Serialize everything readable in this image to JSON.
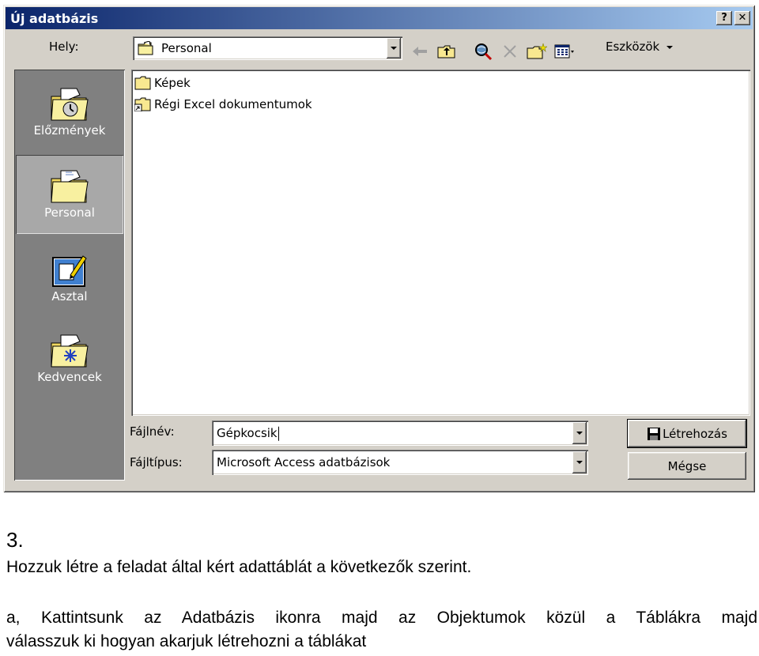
{
  "dialog": {
    "title": "Új adatbázis",
    "help_button": "?",
    "close_button": "✕",
    "location_label": "Hely:",
    "location_value": "Personal",
    "tools_label": "Eszközök"
  },
  "sidebar": {
    "items": [
      {
        "label": "Előzmények",
        "icon": "history-folder-icon"
      },
      {
        "label": "Personal",
        "icon": "personal-folder-icon",
        "selected": true
      },
      {
        "label": "Asztal",
        "icon": "desktop-icon"
      },
      {
        "label": "Kedvencek",
        "icon": "favorites-folder-icon"
      }
    ]
  },
  "files": [
    {
      "name": "Képek",
      "icon": "folder-icon"
    },
    {
      "name": "Régi Excel dokumentumok",
      "icon": "folder-shortcut-icon"
    }
  ],
  "form": {
    "filename_label": "Fájlnév:",
    "filename_value": "Gépkocsik",
    "filetype_label": "Fájltípus:",
    "filetype_value": "Microsoft Access adatbázisok"
  },
  "buttons": {
    "create": "Létrehozás",
    "cancel": "Mégse"
  },
  "document": {
    "step": "3.",
    "line1": "Hozzuk létre a feladat által kért adattáblát a következők szerint.",
    "line2": "a, Kattintsunk az Adatbázis ikonra majd az Objektumok közül a Táblákra majd",
    "line3": "válasszuk ki hogyan akarjuk létrehozni a táblákat"
  },
  "colors": {
    "title_bar_start": "#0a246a",
    "title_bar_end": "#a6caf0",
    "dialog_face": "#d4d0c8",
    "sidebar": "#808080"
  }
}
